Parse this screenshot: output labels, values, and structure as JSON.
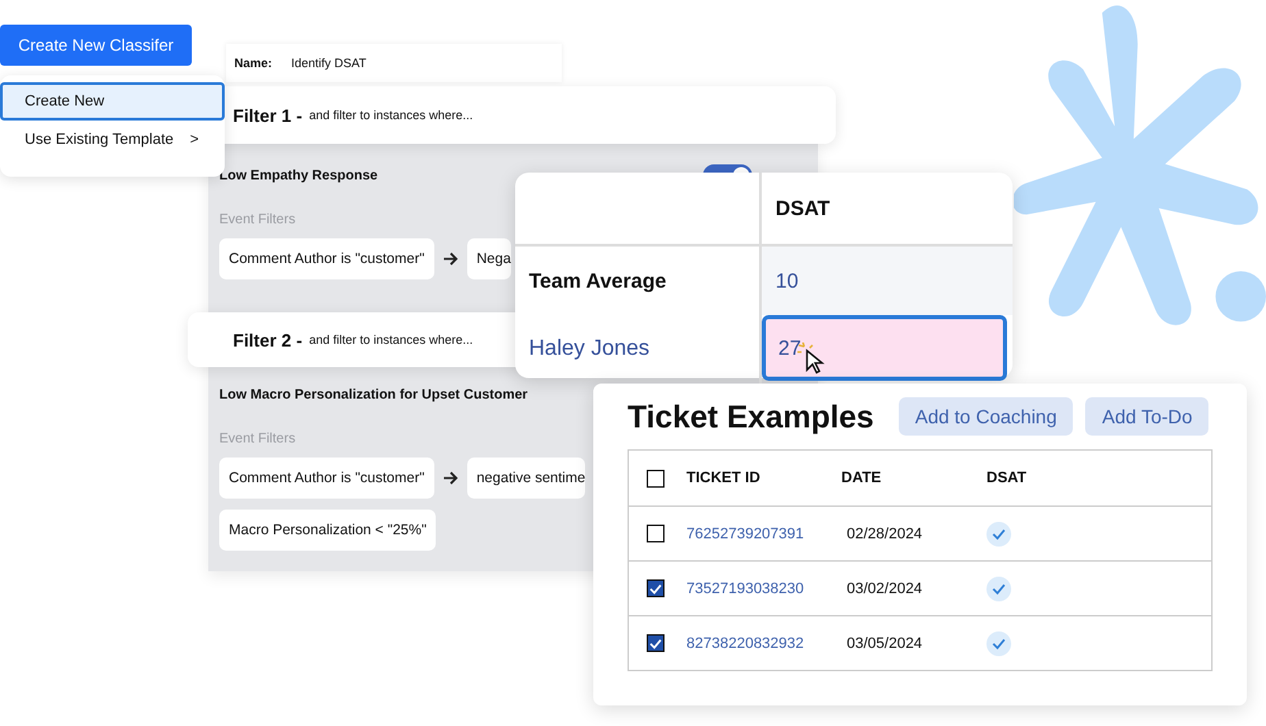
{
  "create_button": {
    "label": "Create New Classifer"
  },
  "menu": {
    "items": [
      {
        "label": "Create New",
        "selected": true
      },
      {
        "label": "Use Existing Template",
        "submenu": ">",
        "selected": false
      }
    ]
  },
  "name_field": {
    "label": "Name:",
    "value": "Identify DSAT"
  },
  "filters": [
    {
      "title": "Filter 1 -",
      "hint": "and filter to instances where..."
    },
    {
      "title": "Filter 2 -",
      "hint": "and filter to instances where..."
    }
  ],
  "classifiers": [
    {
      "title": "Low Empathy Response",
      "toggle_on": true,
      "section": "Event Filters",
      "chip_rows": [
        [
          "Comment Author is \"customer\"",
          "Nega"
        ]
      ]
    },
    {
      "title": "Low Macro Personalization for Upset Customer",
      "section": "Event Filters",
      "chip_rows": [
        [
          "Comment Author is \"customer\"",
          "negative sentime"
        ],
        [
          "Macro Personalization < \"25%\""
        ]
      ]
    }
  ],
  "stats": {
    "column": "DSAT",
    "rows": [
      {
        "label": "Team Average",
        "value": "10",
        "selected": false
      },
      {
        "label": "Haley Jones",
        "value": "27",
        "selected": true
      }
    ]
  },
  "tickets": {
    "title": "Ticket Examples",
    "buttons": [
      "Add to Coaching",
      "Add To-Do"
    ],
    "columns": [
      "TICKET ID",
      "DATE",
      "DSAT"
    ],
    "all_checked": false,
    "rows": [
      {
        "id": "76252739207391",
        "date": "02/28/2024",
        "dsat": true,
        "checked": false
      },
      {
        "id": "73527193038230",
        "date": "03/02/2024",
        "dsat": true,
        "checked": true
      },
      {
        "id": "82738220832932",
        "date": "03/05/2024",
        "dsat": true,
        "checked": true
      }
    ]
  }
}
